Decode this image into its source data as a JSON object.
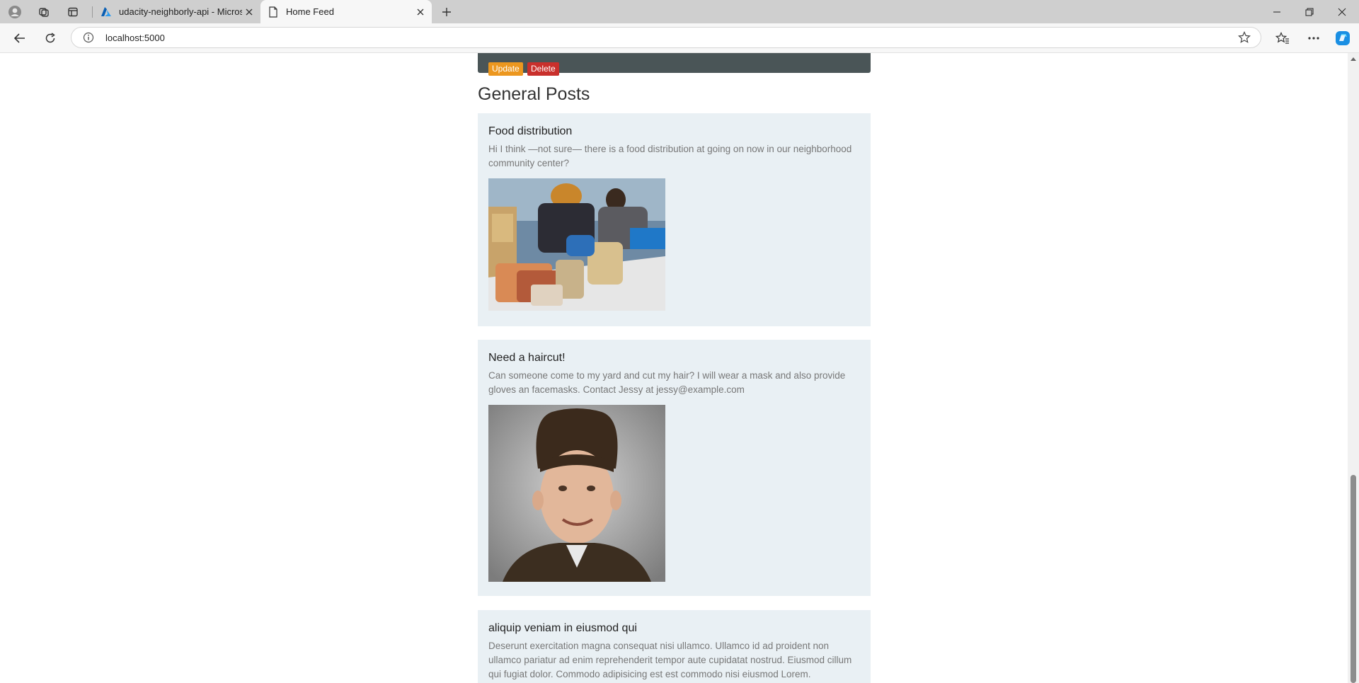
{
  "browser": {
    "tabs": [
      {
        "title": "udacity-neighborly-api - Microsoft Azure",
        "active": false
      },
      {
        "title": "Home Feed",
        "active": true
      }
    ],
    "url": "localhost:5000"
  },
  "page": {
    "top_post": {
      "update_label": "Update",
      "delete_label": "Delete"
    },
    "section_title": "General Posts",
    "posts": [
      {
        "title": "Food distribution",
        "body": "Hi I think —not sure— there is a food distribution at going on now in our neighborhood community center?",
        "image": "food-distribution-photo"
      },
      {
        "title": "Need a haircut!",
        "body": "Can someone come to my yard and cut my hair? I will wear a mask and also provide gloves an facemasks. Contact Jessy at jessy@example.com",
        "image": "haircut-portrait-photo"
      },
      {
        "title": "aliquip veniam in eiusmod qui",
        "body": "Deserunt exercitation magna consequat nisi ullamco. Ullamco id ad proident non ullamco pariatur ad enim reprehenderit tempor aute cupidatat nostrud. Eiusmod cillum qui fugiat dolor. Commodo adipisicing est est commodo nisi eiusmod Lorem."
      }
    ]
  },
  "colors": {
    "update": "#ec971f",
    "delete": "#c9302c",
    "card_bg": "#e9f0f4",
    "dark_card": "#4a5557"
  }
}
